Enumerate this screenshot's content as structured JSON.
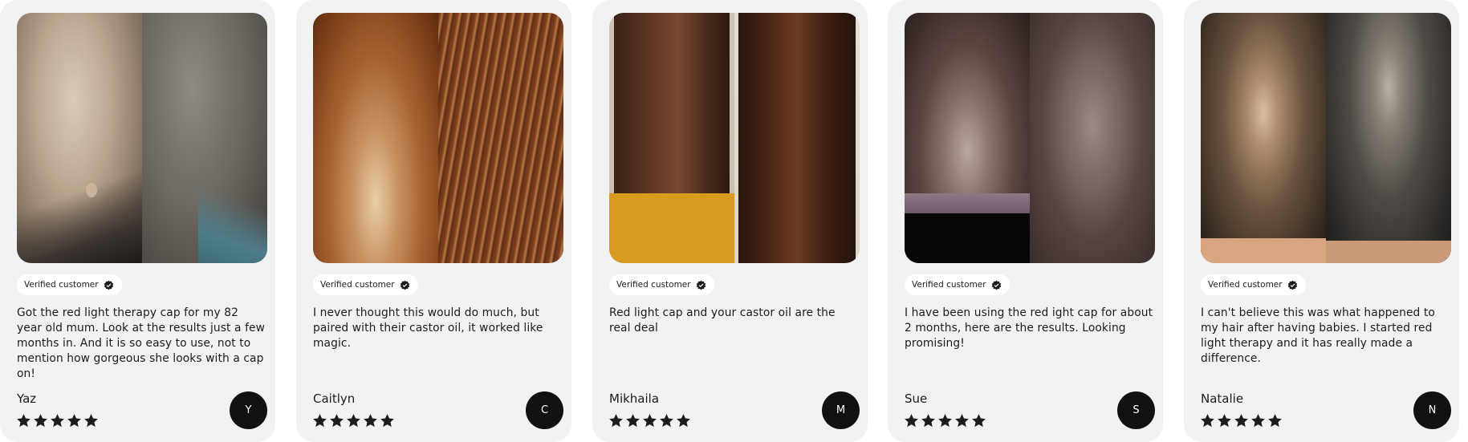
{
  "verified_label": "Verified customer",
  "reviews": [
    {
      "text": "Got the red light therapy cap for my 82 year old mum. Look at the results just a few months in. And it is so easy to use, not to mention how gorgeous she looks with a cap on!",
      "author": "Yaz",
      "initial": "Y",
      "rating": 5
    },
    {
      "text": "I never thought this would do much, but paired with their castor oil, it worked like magic.",
      "author": "Caitlyn",
      "initial": "C",
      "rating": 5
    },
    {
      "text": "Red light cap and your castor oil are the real deal",
      "author": "Mikhaila",
      "initial": "M",
      "rating": 5
    },
    {
      "text": "I have been using the red ight cap for about 2 months, here are the results. Looking promising!",
      "author": "Sue",
      "initial": "S",
      "rating": 5
    },
    {
      "text": "I can't believe this was what happened to my hair after having babies. I started red light therapy and it has really made a difference.",
      "author": "Natalie",
      "initial": "N",
      "rating": 5
    }
  ],
  "colors": {
    "card_bg": "#f2f2f2",
    "avatar_bg": "#111111",
    "star": "#1c1c1c"
  }
}
